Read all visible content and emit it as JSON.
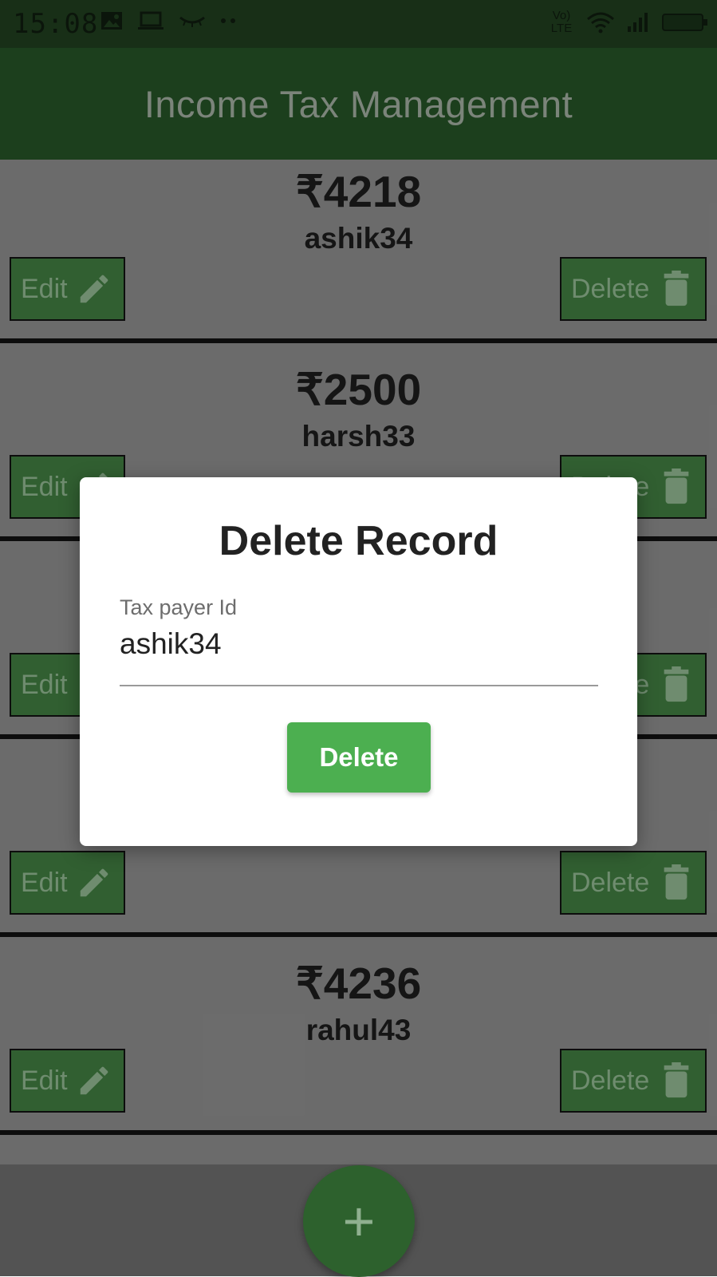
{
  "status_bar": {
    "time": "15:08",
    "network_label": "Vo) LTE"
  },
  "app_bar": {
    "title": "Income Tax Management"
  },
  "records": [
    {
      "amount": "₹4218",
      "payer_id": "ashik34",
      "edit_label": "Edit",
      "delete_label": "Delete"
    },
    {
      "amount": "₹2500",
      "payer_id": "harsh33",
      "edit_label": "Edit",
      "delete_label": "Delete"
    },
    {
      "amount": "",
      "payer_id": "",
      "edit_label": "Edit",
      "delete_label": "Delete"
    },
    {
      "amount": "",
      "payer_id": "",
      "edit_label": "Edit",
      "delete_label": "Delete"
    },
    {
      "amount": "₹4236",
      "payer_id": "rahul43",
      "edit_label": "Edit",
      "delete_label": "Delete"
    }
  ],
  "fab": {
    "label": "+"
  },
  "dialog": {
    "title": "Delete Record",
    "field_label": "Tax payer Id",
    "field_value": "ashik34",
    "button_label": "Delete"
  },
  "colors": {
    "primary": "#4caf50",
    "app_bar": "#245126",
    "button": "#3f7a3f"
  }
}
